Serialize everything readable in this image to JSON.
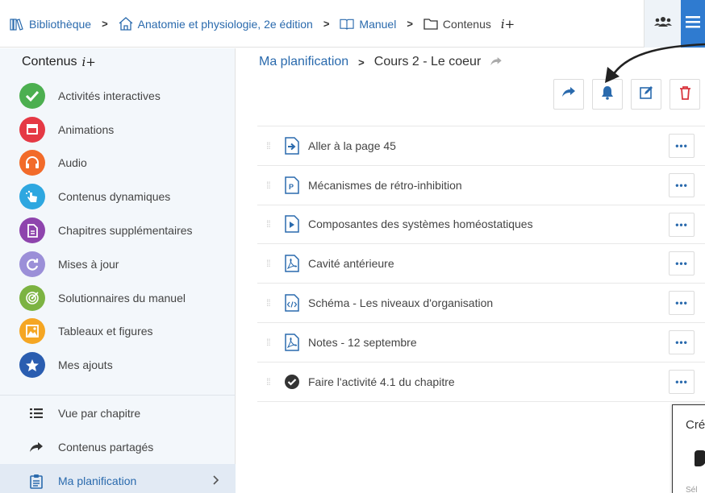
{
  "breadcrumb": {
    "library": "Bibliothèque",
    "book": "Anatomie et physiologie, 2e édition",
    "manual": "Manuel",
    "contents": "Contenus"
  },
  "sidebar": {
    "title": "Contenus",
    "categories": [
      {
        "label": "Activités interactives",
        "color": "#4caf50",
        "icon": "check-icon"
      },
      {
        "label": "Animations",
        "color": "#e53945",
        "icon": "film-icon"
      },
      {
        "label": "Audio",
        "color": "#f26b2a",
        "icon": "headphones-icon"
      },
      {
        "label": "Contenus dynamiques",
        "color": "#2ea7e0",
        "icon": "touch-icon"
      },
      {
        "label": "Chapitres supplémentaires",
        "color": "#8e44ad",
        "icon": "document-icon"
      },
      {
        "label": "Mises à jour",
        "color": "#9b8fd8",
        "icon": "refresh-icon"
      },
      {
        "label": "Solutionnaires du manuel",
        "color": "#7cb342",
        "icon": "target-icon"
      },
      {
        "label": "Tableaux et figures",
        "color": "#f5a623",
        "icon": "image-icon"
      },
      {
        "label": "Mes ajouts",
        "color": "#2a5db0",
        "icon": "star-icon"
      }
    ],
    "nav": [
      {
        "label": "Vue par chapitre",
        "icon": "list-icon"
      },
      {
        "label": "Contenus partagés",
        "icon": "share-arrow-icon"
      },
      {
        "label": "Ma planification",
        "icon": "clipboard-icon",
        "active": true
      }
    ]
  },
  "main": {
    "crumb_parent": "Ma planification",
    "crumb_current": "Cours 2 - Le coeur",
    "items": [
      {
        "label": "Aller à la page 45",
        "icon": "page-link-icon"
      },
      {
        "label": "Mécanismes de rétro-inhibition",
        "icon": "powerpoint-file-icon"
      },
      {
        "label": "Composantes des systèmes homéostatiques",
        "icon": "video-file-icon"
      },
      {
        "label": "Cavité antérieure",
        "icon": "pdf-file-icon"
      },
      {
        "label": "Schéma - Les niveaux d'organisation",
        "icon": "code-file-icon"
      },
      {
        "label": "Notes - 12 septembre",
        "icon": "pdf-file-icon"
      },
      {
        "label": "Faire l'activité 4.1 du chapitre",
        "icon": "check-circle-icon"
      }
    ],
    "more_label": "•••"
  },
  "popup": {
    "title": "Cré",
    "subtitle": "Sél"
  },
  "colors": {
    "accent": "#2a6aad",
    "menu_blue": "#2f7bd0",
    "delete_red": "#d9363e"
  }
}
